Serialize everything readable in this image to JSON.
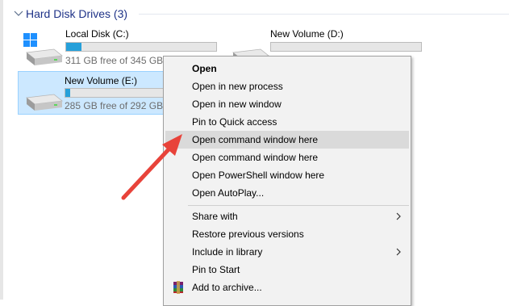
{
  "section": {
    "title": "Hard Disk Drives (3)"
  },
  "drives": [
    {
      "name": "Local Disk (C:)",
      "free_text": "311 GB free of 345 GB",
      "used_fraction": 0.1
    },
    {
      "name": "New Volume (D:)",
      "free_text": "",
      "used_fraction": 0.0
    },
    {
      "name": "New Volume (E:)",
      "free_text": "285 GB free of 292 GB",
      "used_fraction": 0.03
    }
  ],
  "menu": {
    "items": [
      {
        "label": "Open",
        "bold": true
      },
      {
        "label": "Open in new process"
      },
      {
        "label": "Open in new window"
      },
      {
        "label": "Pin to Quick access"
      },
      {
        "label": "Open command window here",
        "highlighted": true
      },
      {
        "label": "Open command window here"
      },
      {
        "label": "Open PowerShell window here"
      },
      {
        "label": "Open AutoPlay..."
      },
      {
        "label": "Share with",
        "submenu": true
      },
      {
        "label": "Restore previous versions"
      },
      {
        "label": "Include in library",
        "submenu": true
      },
      {
        "label": "Pin to Start"
      },
      {
        "label": "Add to archive...",
        "icon": "winrar-icon"
      }
    ]
  },
  "colors": {
    "selection": "#cce8ff",
    "selection_border": "#99d1ff",
    "usage_bar": "#26a0da",
    "section_title": "#1e3287",
    "menu_highlight": "#dadada",
    "annotation_arrow": "#e8433a"
  }
}
